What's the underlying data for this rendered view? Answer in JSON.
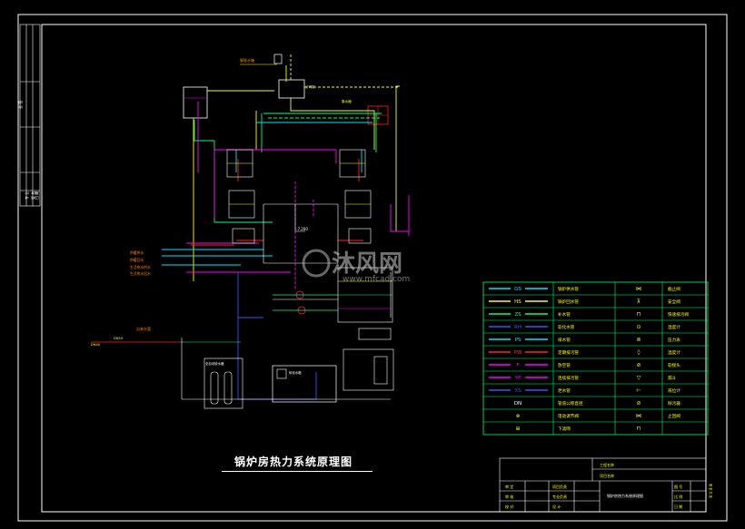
{
  "drawing": {
    "title": "锅炉房热力系统原理图",
    "watermark_text": "沐风网",
    "watermark_url": "www.mfcad.com",
    "elevation_label": "-7.200",
    "colors": {
      "background": "#000000",
      "frame": "#ffffff",
      "legend_border": "#00ff66",
      "gs": "#00e5ff",
      "hs": "#ffff00",
      "zs": "#00ff88",
      "rh": "#3355ff",
      "ps": "#00e5ff",
      "pw": "#ff2222",
      "f": "#ff00ff",
      "yp": "#ff00ff",
      "xs": "#3355ff",
      "equipment": "#ffffff",
      "label": "#ff8800"
    }
  },
  "legend": {
    "rows": [
      {
        "code": "GS",
        "name": "锅炉供水管",
        "symbol_name": "gate-valve-icon",
        "symbol_label": "截止阀"
      },
      {
        "code": "HS",
        "name": "锅炉回水管",
        "symbol_name": "safety-valve-icon",
        "symbol_label": "安全阀"
      },
      {
        "code": "ZS",
        "name": "补水管",
        "symbol_name": "quick-drain-valve-icon",
        "symbol_label": "快速排污阀"
      },
      {
        "code": "RH",
        "name": "软化水管",
        "symbol_name": "pressure-gauge-icon",
        "symbol_label": "温度计"
      },
      {
        "code": "PS",
        "name": "排水管",
        "symbol_name": "manometer-icon",
        "symbol_label": "压力表"
      },
      {
        "code": "PW",
        "name": "定期排污管",
        "symbol_name": "thermometer-icon",
        "symbol_label": "温度计"
      },
      {
        "code": "F",
        "name": "放空管",
        "symbol_name": "check-valve-icon",
        "symbol_label": "软接头"
      },
      {
        "code": "YP",
        "name": "连续排污管",
        "symbol_name": "funnel-icon",
        "symbol_label": "漏斗"
      },
      {
        "code": "XS",
        "name": "泄水管",
        "symbol_name": "level-gauge-icon",
        "symbol_label": "液位计"
      },
      {
        "code": "DN",
        "name": "管道公称直径",
        "symbol_name": "filter-icon",
        "symbol_label": "除污器"
      },
      {
        "code": "",
        "name": "电动调节阀",
        "symbol_name": "butterfly-valve-icon",
        "symbol_label": "止回阀"
      },
      {
        "code": "",
        "name": "下滤网",
        "symbol_name": "strainer-icon",
        "symbol_label": ""
      }
    ]
  },
  "titleblock": {
    "project_name_label": "工程名称",
    "item_name_label": "项目名称",
    "drawing_title": "锅炉房热力系统原理图",
    "left_cells": [
      "审 定",
      "审 核",
      "校 对"
    ],
    "mid_cells": [
      "项目负责",
      "专业负责",
      "设 计"
    ],
    "right_cells": [
      "图 号",
      "比 例",
      "日 期"
    ],
    "sheet": "第 张 共 张"
  },
  "side_strip": {
    "labels": [
      "会 签",
      "专 业",
      "签 名",
      "日 期"
    ]
  },
  "inlet_labels": [
    "自来水管",
    "DN50",
    "DN40"
  ],
  "pipe_labels_left": [
    "供暖供水",
    "供暖回水",
    "生活热水供水",
    "生活热水回水"
  ],
  "equipment_labels": {
    "expansion_tank": "膨胀水箱",
    "softener": "全自动软水器",
    "water_tank": "软化水箱",
    "top_box": "分汽缸",
    "right_label": "集水器"
  }
}
